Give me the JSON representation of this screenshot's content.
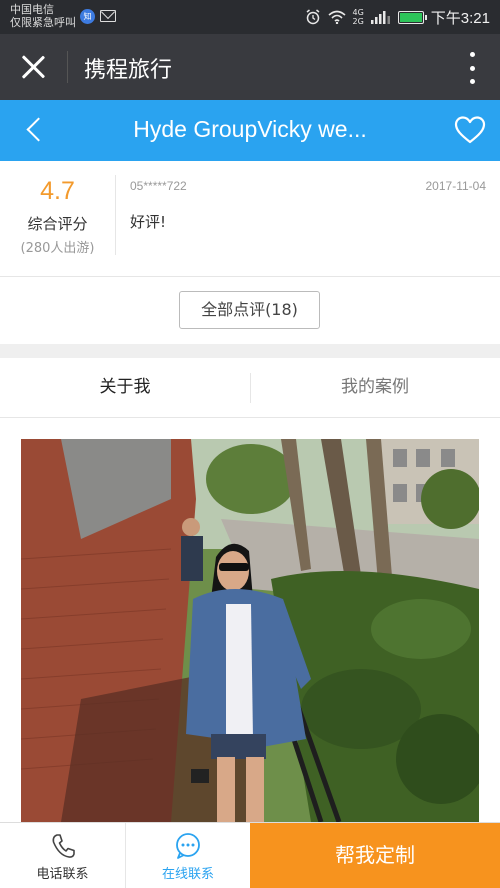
{
  "status_bar": {
    "carrier": "中国电信",
    "emergency": "仅限紧急呼叫",
    "zhi_badge": "知",
    "time": "下午3:21",
    "icons": [
      "alarm-icon",
      "wifi-icon",
      "signal-icon",
      "battery-icon"
    ]
  },
  "app_bar": {
    "title": "携程旅行"
  },
  "nav_bar": {
    "title": "Hyde GroupVicky we..."
  },
  "score": {
    "value": "4.7",
    "label": "综合评分",
    "count": "(280人出游)"
  },
  "review": {
    "reviewer": "05*****722",
    "date": "2017-11-04",
    "text": "好评!"
  },
  "all_reviews_label": "全部点评(18)",
  "tabs": [
    {
      "label": "关于我"
    },
    {
      "label": "我的案例"
    }
  ],
  "bottom_bar": {
    "phone_label": "电话联系",
    "chat_label": "在线联系",
    "custom_label": "帮我定制"
  },
  "colors": {
    "nav_blue": "#2aa3f0",
    "accent_orange": "#f7931e",
    "score_orange": "#f39a2c"
  }
}
